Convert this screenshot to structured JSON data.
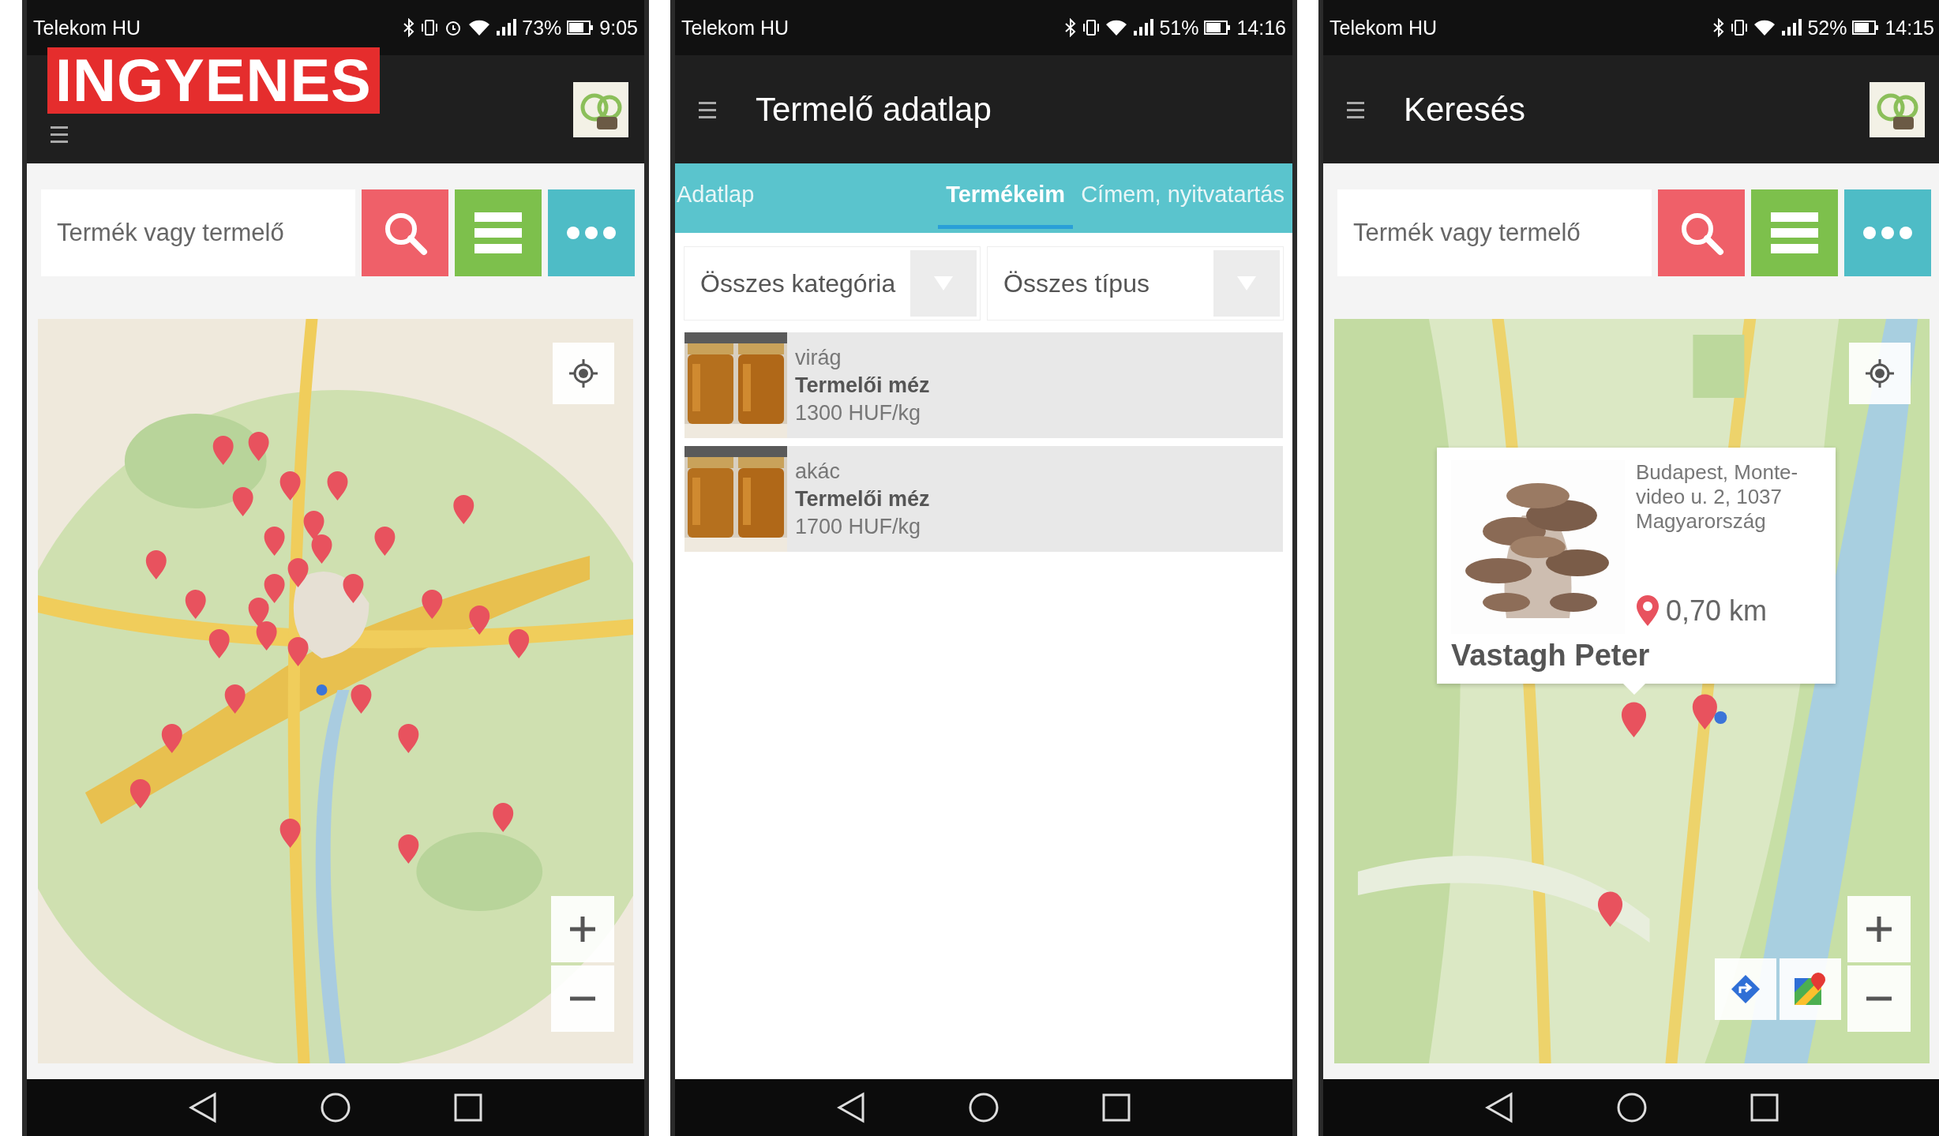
{
  "phones": [
    {
      "kind": "search",
      "status_bar": {
        "carrier": "Telekom HU",
        "alarm": true,
        "battery": "73%",
        "time": "9:05"
      },
      "banner": "INGYENES",
      "app_bar": {
        "logo": true
      },
      "search": {
        "placeholder": "Termék vagy termelő"
      }
    },
    {
      "kind": "detail",
      "status_bar": {
        "carrier": "Telekom HU",
        "alarm": false,
        "battery": "51%",
        "time": "14:16"
      },
      "app_bar": {
        "title": "Termelő adatlap",
        "logo": false
      },
      "tabs": [
        {
          "label": "Adatlap",
          "selected": false
        },
        {
          "label": "Termékeim",
          "selected": true
        },
        {
          "label": "Címem, nyitvatartás",
          "selected": false
        }
      ],
      "filters": [
        "Összes kategória",
        "Összes típus"
      ],
      "products": [
        {
          "type": "virág",
          "name": "Termelői méz",
          "price": "1300 HUF/kg"
        },
        {
          "type": "akác",
          "name": "Termelői méz",
          "price": "1700 HUF/kg"
        }
      ]
    },
    {
      "kind": "search",
      "status_bar": {
        "carrier": "Telekom HU",
        "alarm": false,
        "battery": "52%",
        "time": "14:15"
      },
      "app_bar": {
        "title": "Keresés",
        "logo": true
      },
      "search": {
        "placeholder": "Termék vagy termelő"
      },
      "popup": {
        "address": "Budapest, Monte-video u. 2, 1037 Magyarország",
        "distance": "0,70 km",
        "name": "Vastagh Peter"
      }
    }
  ]
}
